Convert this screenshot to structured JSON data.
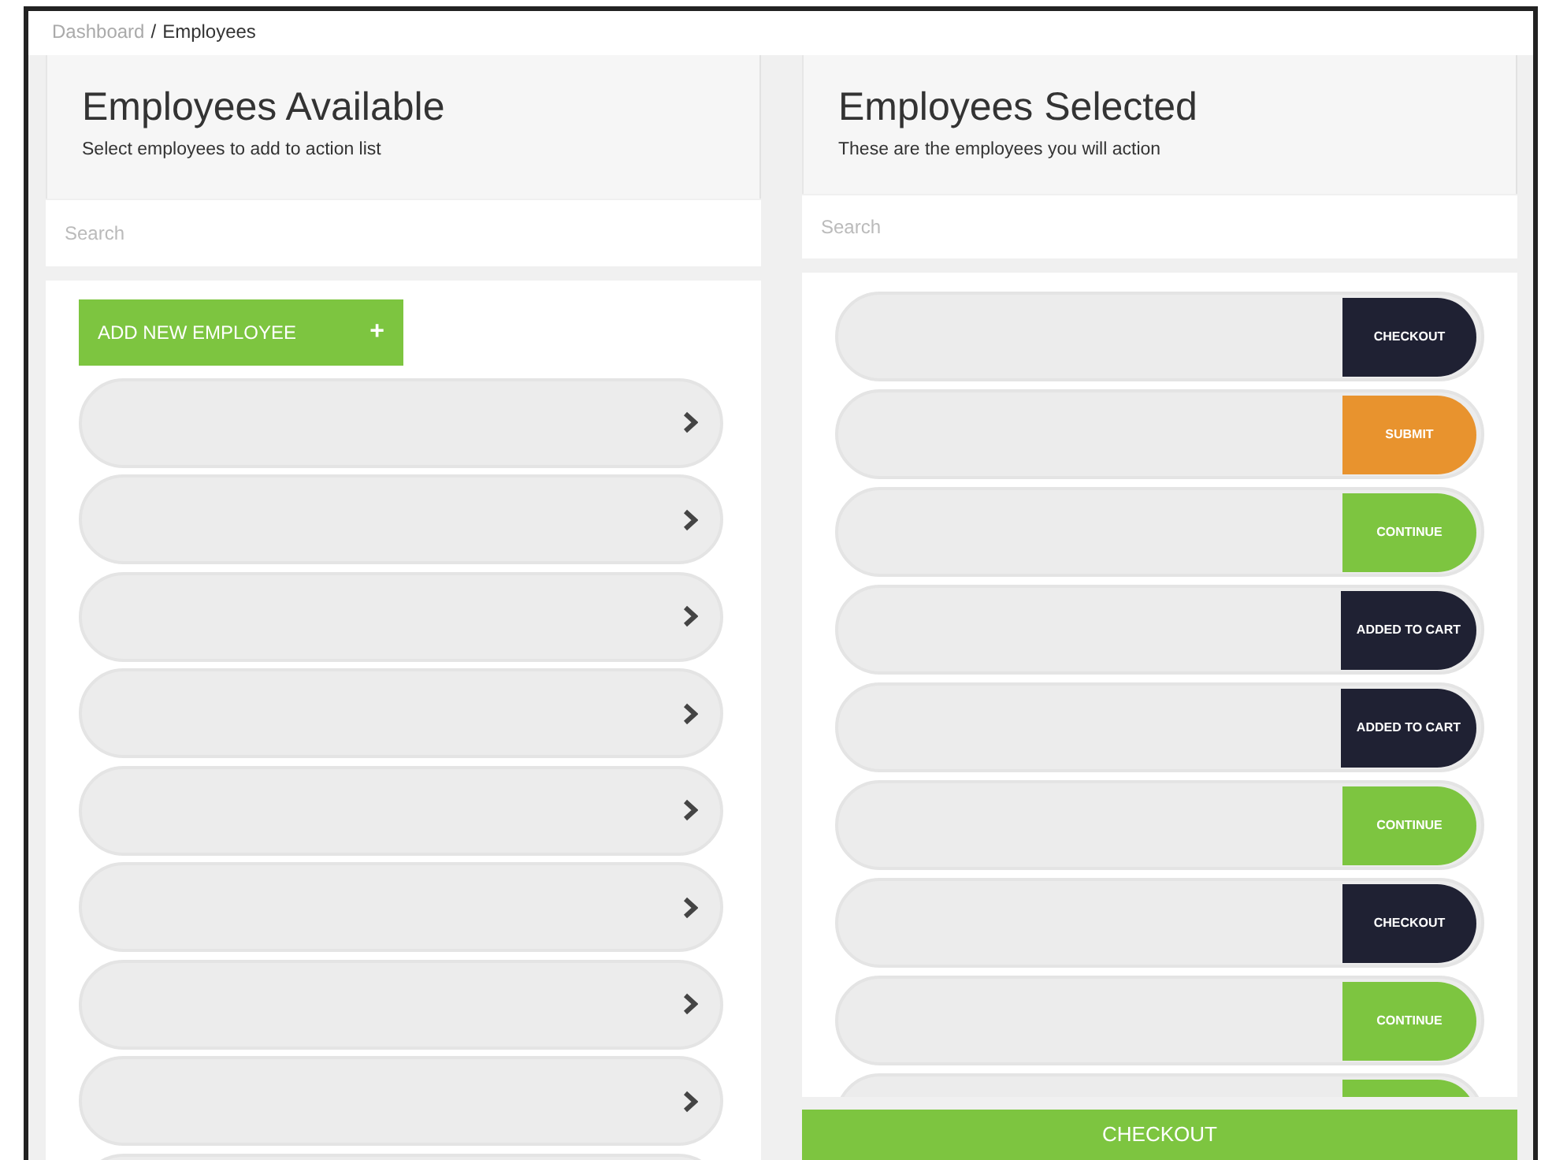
{
  "breadcrumb": [
    {
      "label": "Dashboard",
      "selected": false
    },
    {
      "label": "Employees",
      "selected": true,
      "separator": "/"
    }
  ],
  "available": {
    "title": "Employees Available",
    "subtitle": "Select employees to add to action list",
    "search": {
      "placeholder": "Search"
    },
    "add_button": {
      "label": "ADD NEW EMPLOYEE",
      "icon": "+"
    },
    "rows": [
      {
        "kind": "employee",
        "chevron": true
      },
      {
        "kind": "employee",
        "chevron": true
      },
      {
        "kind": "employee",
        "chevron": true
      },
      {
        "kind": "employee",
        "chevron": true
      },
      {
        "kind": "employee",
        "chevron": true
      },
      {
        "kind": "employee",
        "chevron": true
      },
      {
        "kind": "employee",
        "chevron": true
      },
      {
        "kind": "employee",
        "chevron": true
      },
      {
        "kind": "employee",
        "chevron": false
      }
    ]
  },
  "selected": {
    "title": "Employees Selected",
    "subtitle": "These are the employees you will action",
    "search": {
      "placeholder": "Search"
    },
    "rows": [
      {
        "action": "CHECKOUT",
        "color": "#1f2133"
      },
      {
        "action": "SUBMIT",
        "color": "#e8932e"
      },
      {
        "action": "CONTINUE",
        "color": "#7dc540"
      },
      {
        "action": "ADDED TO CART",
        "color": "#1f2133"
      },
      {
        "action": "ADDED TO CART",
        "color": "#1f2133"
      },
      {
        "action": "CONTINUE",
        "color": "#7dc540"
      },
      {
        "action": "CHECKOUT",
        "color": "#1f2133"
      },
      {
        "action": "CONTINUE",
        "color": "#7dc540"
      },
      {
        "color": "#7dc540"
      }
    ],
    "footer_button": {
      "label": "CHECKOUT"
    }
  }
}
